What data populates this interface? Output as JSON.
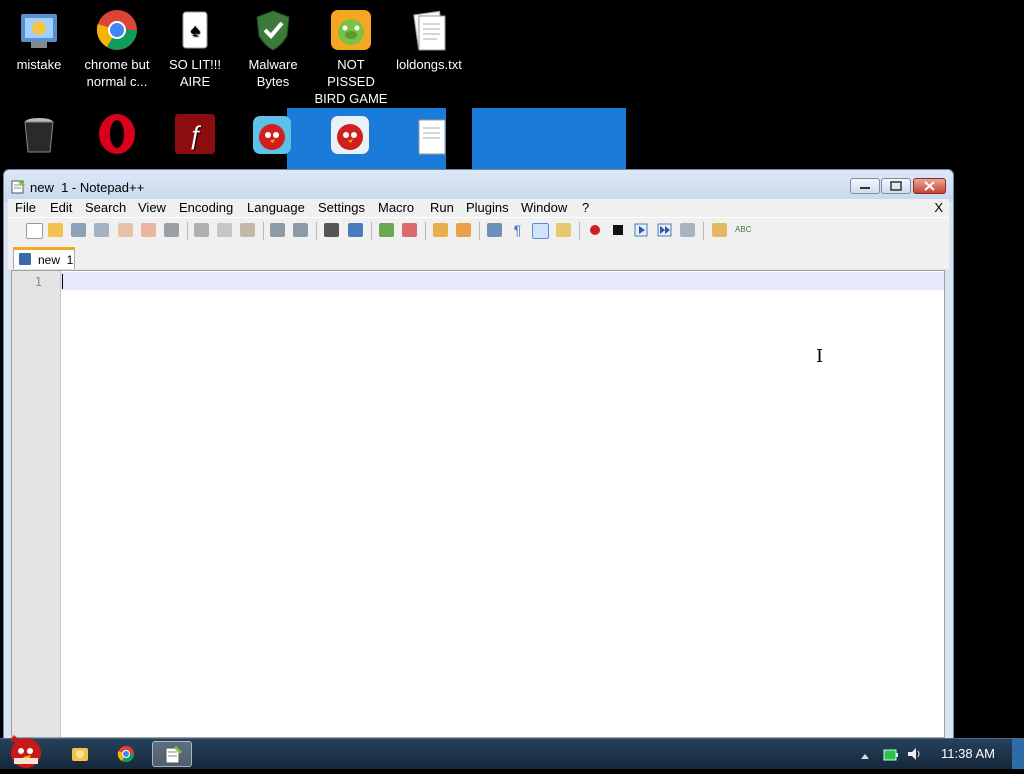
{
  "desktop": {
    "icons_row1": [
      {
        "name": "mistake-icon",
        "label": "mistake"
      },
      {
        "name": "chrome-icon",
        "label": "chrome but normal c..."
      },
      {
        "name": "solitaire-icon",
        "label": "SO LIT!!! AIRE"
      },
      {
        "name": "malwarebytes-icon",
        "label": "Malware Bytes"
      },
      {
        "name": "bad-piggies-icon",
        "label": "NOT PISSED BIRD GAME"
      },
      {
        "name": "text-file-icon",
        "label": "loldongs.txt"
      }
    ]
  },
  "window": {
    "title": "new  1 - Notepad++",
    "menu": [
      "File",
      "Edit",
      "Search",
      "View",
      "Encoding",
      "Language",
      "Settings",
      "Macro",
      "Run",
      "Plugins",
      "Window",
      "?"
    ],
    "menu_close": "X",
    "tab_label": "new  1",
    "line_number": "1"
  },
  "taskbar": {
    "clock": "11:38 AM"
  },
  "colors": {
    "accent": "#f5a623",
    "selection": "#1e90ff"
  }
}
